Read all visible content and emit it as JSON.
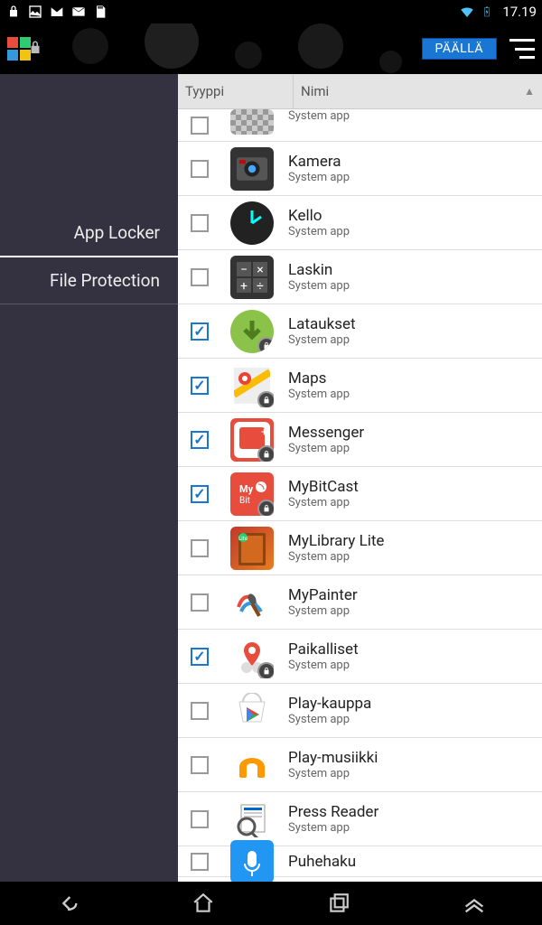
{
  "status": {
    "time": "17.19"
  },
  "actionbar": {
    "toggle": "PÄÄLLÄ"
  },
  "sidebar": {
    "items": [
      {
        "label": "App Locker",
        "active": true
      },
      {
        "label": "File Protection",
        "active": false
      }
    ]
  },
  "headers": {
    "type": "Tyyppi",
    "name": "Nimi"
  },
  "apps": [
    {
      "name": "",
      "sub": "System app",
      "checked": false,
      "locked": false,
      "icon": "ic-checker",
      "partial": true
    },
    {
      "name": "Kamera",
      "sub": "System app",
      "checked": false,
      "locked": false,
      "icon": "ic-camera"
    },
    {
      "name": "Kello",
      "sub": "System app",
      "checked": false,
      "locked": false,
      "icon": "ic-clock"
    },
    {
      "name": "Laskin",
      "sub": "System app",
      "checked": false,
      "locked": false,
      "icon": "ic-calc"
    },
    {
      "name": "Lataukset",
      "sub": "System app",
      "checked": true,
      "locked": true,
      "icon": "ic-download"
    },
    {
      "name": "Maps",
      "sub": "System app",
      "checked": true,
      "locked": true,
      "icon": "ic-maps"
    },
    {
      "name": "Messenger",
      "sub": "System app",
      "checked": true,
      "locked": true,
      "icon": "ic-messenger"
    },
    {
      "name": "MyBitCast",
      "sub": "System app",
      "checked": true,
      "locked": true,
      "icon": "ic-mybitcast"
    },
    {
      "name": "MyLibrary Lite",
      "sub": "System app",
      "checked": false,
      "locked": false,
      "icon": "ic-library"
    },
    {
      "name": "MyPainter",
      "sub": "System app",
      "checked": false,
      "locked": false,
      "icon": "ic-painter"
    },
    {
      "name": "Paikalliset",
      "sub": "System app",
      "checked": true,
      "locked": true,
      "icon": "ic-places"
    },
    {
      "name": "Play-kauppa",
      "sub": "System app",
      "checked": false,
      "locked": false,
      "icon": "ic-play"
    },
    {
      "name": "Play-musiikki",
      "sub": "System app",
      "checked": false,
      "locked": false,
      "icon": "ic-music"
    },
    {
      "name": "Press Reader",
      "sub": "System app",
      "checked": false,
      "locked": false,
      "icon": "ic-press"
    },
    {
      "name": "Puhehaku",
      "sub": "",
      "checked": false,
      "locked": false,
      "icon": "ic-puhehaku",
      "partialBottom": true
    }
  ]
}
